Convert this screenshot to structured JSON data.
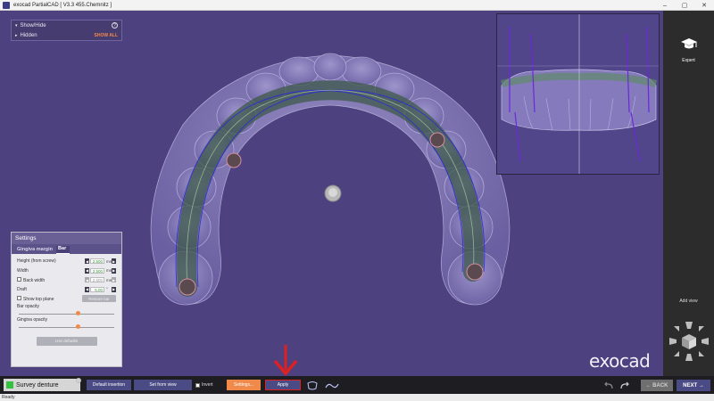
{
  "window": {
    "title": "exocad PartialCAD [ V3.3 455.Chemnitz ]",
    "minimize": "–",
    "maximize": "▢",
    "close": "✕"
  },
  "panel_showhide": {
    "show_hide_label": "Show/Hide",
    "hidden_label": "Hidden",
    "show_all_label": "SHOW ALL",
    "help_symbol": "?"
  },
  "settings": {
    "title": "Settings",
    "tabs": [
      "Gingiva margin",
      "Bar"
    ],
    "active_tab": "Bar",
    "fields": {
      "height": {
        "label": "Height (from screw)",
        "value": "2.500",
        "unit": "mm"
      },
      "width": {
        "label": "Width",
        "value": "2.500",
        "unit": "mm"
      },
      "back_width": {
        "label": "Back width",
        "value": "2.500",
        "unit": "mm"
      },
      "draft": {
        "label": "Draft",
        "value": "5.00",
        "unit": "°"
      }
    },
    "show_top_plane_label": "Show top plane",
    "restore_btn": "Restore bar",
    "bar_opacity_label": "Bar opacity",
    "bar_opacity": 0.62,
    "gingiva_opacity_label": "Gingiva opacity",
    "gingiva_opacity": 0.62,
    "use_defaults_btn": "Use defaults"
  },
  "rightbar": {
    "expert_label": "Expert",
    "add_view_label": "Add view"
  },
  "logo": "exocad",
  "bottom": {
    "step_title": "Survey denture",
    "help_symbol": "?",
    "default_insertion": "Default insertion",
    "set_from_view": "Set from view",
    "invert_label": "Invert",
    "settings_btn": "Settings...",
    "apply_btn": "Apply",
    "back_btn": "BACK",
    "next_btn": "NEXT"
  },
  "status": "Ready",
  "colors": {
    "accent_orange": "#f08a4b",
    "annotation_red": "#e02020",
    "success_green": "#33c240",
    "viewport_bg": "#4d417f"
  }
}
